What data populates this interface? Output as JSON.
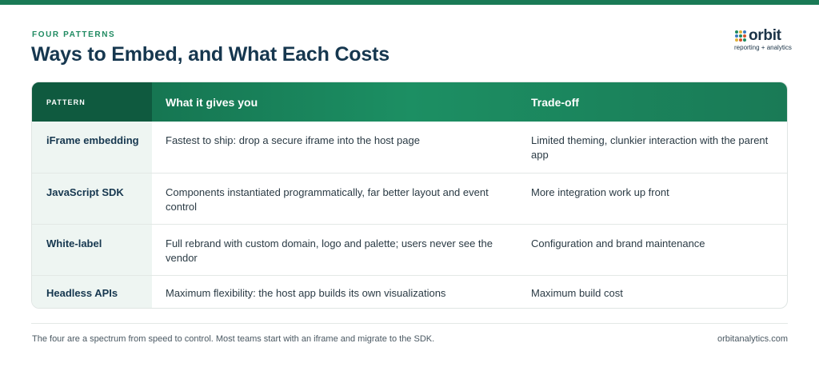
{
  "header": {
    "eyebrow": "FOUR PATTERNS",
    "title": "Ways to Embed, and What Each Costs"
  },
  "brand": {
    "name": "orbit",
    "tagline": "reporting + analytics",
    "icon": "grid-dots-icon",
    "colors": [
      "#1f8a61",
      "#e0b23a",
      "#3b7bc2",
      "#d0532e"
    ]
  },
  "table": {
    "columns": [
      "PATTERN",
      "What it gives you",
      "Trade-off"
    ],
    "rows": [
      {
        "pattern": "iFrame embedding",
        "gives": "Fastest to ship: drop a secure iframe into the host page",
        "tradeoff": "Limited theming, clunkier interaction with the parent app"
      },
      {
        "pattern": "JavaScript SDK",
        "gives": "Components instantiated programmatically, far better layout and event control",
        "tradeoff": "More integration work up front"
      },
      {
        "pattern": "White-label",
        "gives": "Full rebrand with custom domain, logo and palette; users never see the vendor",
        "tradeoff": "Configuration and brand maintenance"
      },
      {
        "pattern": "Headless APIs",
        "gives": "Maximum flexibility: the host app builds its own visualizations",
        "tradeoff": "Maximum build cost"
      }
    ]
  },
  "footer": {
    "note": "The four are a spectrum from speed to control. Most teams start with an iframe and migrate to the SDK.",
    "site": "orbitanalytics.com"
  },
  "theme": {
    "accent": "#1f8a61",
    "header_dark": "#0f5a3f",
    "title_color": "#16374f"
  }
}
